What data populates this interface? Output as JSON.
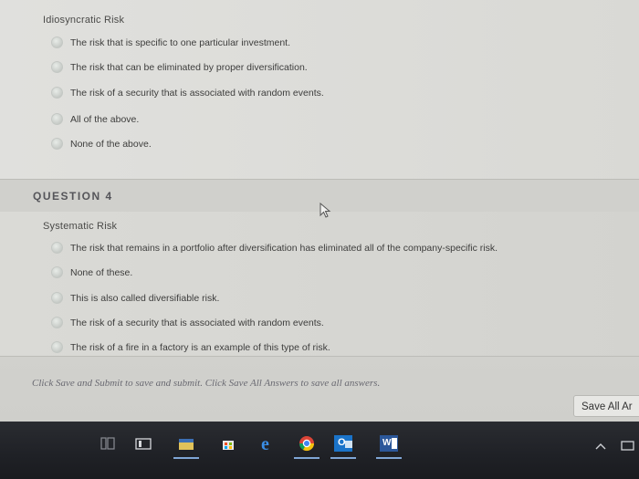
{
  "question3": {
    "title": "Idiosyncratic Risk",
    "options": [
      "The risk that is specific to one particular investment.",
      "The risk that can be eliminated by proper diversification.",
      "The risk of a security that is associated with random events.",
      "All of the above.",
      "None of the above."
    ]
  },
  "question4": {
    "header": "QUESTION 4",
    "title": "Systematic Risk",
    "options": [
      "The risk that remains in a portfolio after diversification has eliminated all of the company-specific risk.",
      "None of these.",
      "This is also called diversifiable risk.",
      "The risk of a security that is associated with random events.",
      "The risk of a fire in a factory is an example of this type of risk."
    ]
  },
  "footer": {
    "note": "Click Save and Submit to save and submit. Click Save All Answers to save all answers.",
    "save_all_label": "Save All Ar"
  },
  "taskbar": {
    "icons": [
      "task-view-icon",
      "file-explorer-icon",
      "store-icon",
      "edge-icon",
      "chrome-icon",
      "outlook-icon",
      "word-icon",
      "chevron-up-icon",
      "notification-icon"
    ],
    "outlook_label": "O",
    "word_label": "W"
  },
  "colors": {
    "page_bg": "#d9d9d6",
    "taskbar_bg": "#1f2126",
    "accent_underline": "#7fa6d6"
  }
}
